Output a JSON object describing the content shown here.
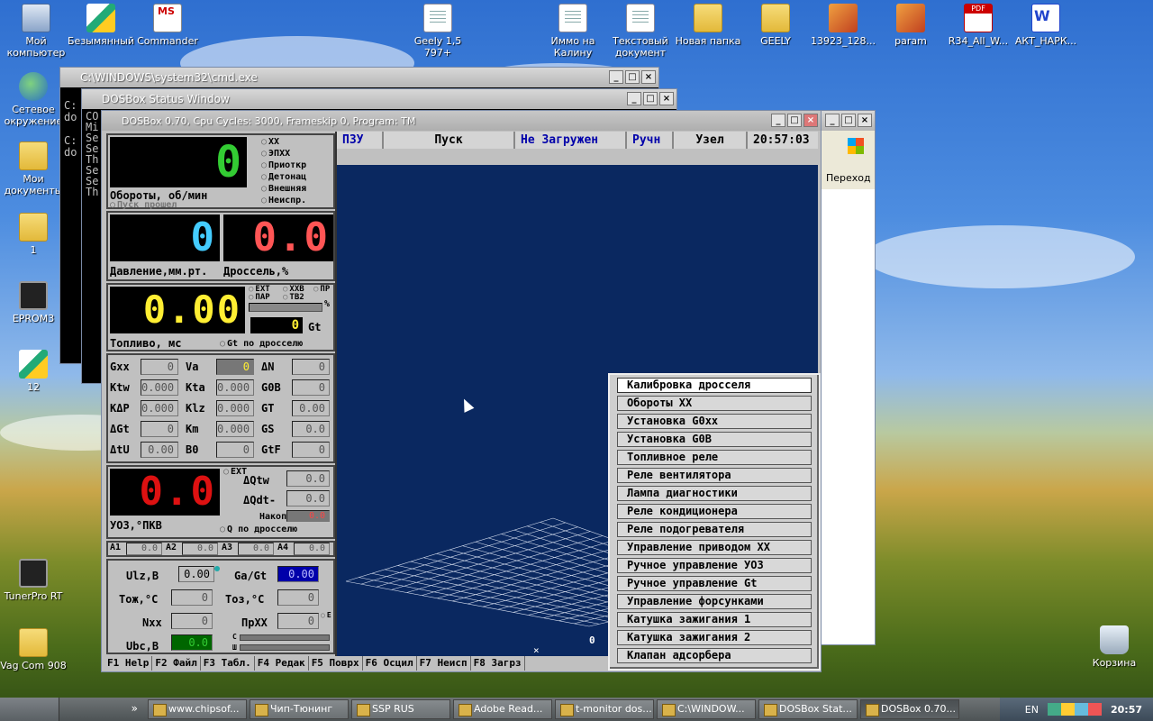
{
  "desktop_icons": [
    {
      "label": "Мой\nкомпьютер",
      "kind": "comp"
    },
    {
      "label": "Безымянный",
      "kind": "paint"
    },
    {
      "label": "Commander",
      "kind": "msdos"
    },
    {
      "label": "Geely 1,5\n797+",
      "kind": "doc"
    },
    {
      "label": "Иммо на\nКалину",
      "kind": "doc"
    },
    {
      "label": "Текстовый\nдокумент",
      "kind": "doc"
    },
    {
      "label": "Новая папка",
      "kind": "folder"
    },
    {
      "label": "GEELY",
      "kind": "folder"
    },
    {
      "label": "13923_128...",
      "kind": "pic"
    },
    {
      "label": "param",
      "kind": "pic"
    },
    {
      "label": "R34_All_W...",
      "kind": "pdf"
    },
    {
      "label": "АКТ_НАРК...",
      "kind": "word"
    },
    {
      "label": "Сетевое\nокружение",
      "kind": "net"
    },
    {
      "label": "Мои\nдокументы",
      "kind": "folder"
    },
    {
      "label": "1",
      "kind": "folder"
    },
    {
      "label": "EPROM3",
      "kind": "chip"
    },
    {
      "label": "12",
      "kind": "paint"
    },
    {
      "label": "TunerPro RT",
      "kind": "chip"
    },
    {
      "label": "Vag Com 908",
      "kind": "folder"
    },
    {
      "label": "Корзина",
      "kind": "bin"
    }
  ],
  "windows": {
    "cmd_title": "C:\\WINDOWS\\system32\\cmd.exe",
    "cmd_lines": [
      "C:",
      "do",
      "",
      "C:",
      "do"
    ],
    "status_title": "DOSBox Status Window",
    "status_lines": [
      "CO",
      "Mi",
      "Se",
      "Se",
      "Th",
      "Se",
      "Se",
      "Th"
    ],
    "dosbox_title": "DOSBox 0.70, Cpu Cycles:    3000, Frameskip  0, Program:    TM",
    "back_window_text": "Переход"
  },
  "app": {
    "status_bar": [
      "ПЗУ",
      "Пуск",
      "Не Загружен",
      "Ручн",
      "Узел",
      "20:57:03"
    ],
    "rpm": {
      "value": "0",
      "label": "Обороты, об/мин",
      "sub": "Пуск прошел"
    },
    "modes": [
      "ХХ",
      "ЭПХХ",
      "Приоткр",
      "Детонац",
      "Внешняя",
      "Неиспр."
    ],
    "pressure": {
      "value": "0",
      "label": "Давление,мм.рт."
    },
    "throttle": {
      "value": "0.0",
      "label": "Дроссель,%"
    },
    "fuel": {
      "value": "0.00",
      "label": "Топливо, мс",
      "gt_value": "0",
      "gt_unit": "Gt",
      "gt_opt": "Gt по дросселю",
      "pct": "%"
    },
    "fuel_opts": [
      "EXT",
      "XXB",
      "ПР",
      "ПАР",
      "ТВ2"
    ],
    "params": [
      {
        "k": "Gxx",
        "v": "0"
      },
      {
        "k": "Va",
        "v": "0"
      },
      {
        "k": "ΔN",
        "v": "0"
      },
      {
        "k": "Ktw",
        "v": "0.000"
      },
      {
        "k": "Kta",
        "v": "0.000"
      },
      {
        "k": "G0B",
        "v": "0"
      },
      {
        "k": "KΔP",
        "v": "0.000"
      },
      {
        "k": "Klz",
        "v": "0.000"
      },
      {
        "k": "GT",
        "v": "0.00"
      },
      {
        "k": "ΔGt",
        "v": "0"
      },
      {
        "k": "Km",
        "v": "0.000"
      },
      {
        "k": "GS",
        "v": "0.0"
      },
      {
        "k": "ΔtU",
        "v": "0.00"
      },
      {
        "k": "B0",
        "v": "0"
      },
      {
        "k": "GtF",
        "v": "0"
      }
    ],
    "uoz": {
      "value": "0.0",
      "label": "УОЗ,°ПКВ",
      "ext": "EXT",
      "dqtw": "ΔQtw",
      "dqtw_v": "0.0",
      "dqdt": "ΔQdt-",
      "dqdt_v": "0.0",
      "nakop": "Накоп",
      "nakop_v": "0.0",
      "q_opt": "Q по дросселю"
    },
    "a_values": [
      {
        "k": "A1",
        "v": "0.0"
      },
      {
        "k": "A2",
        "v": "0.0"
      },
      {
        "k": "A3",
        "v": "0.0"
      },
      {
        "k": "A4",
        "v": "0.0"
      }
    ],
    "bottom": [
      {
        "k": "Ulz,B",
        "v": "0.00"
      },
      {
        "k": "Ga/Gt",
        "v": "0.00"
      },
      {
        "k": "Тож,°C",
        "v": "0"
      },
      {
        "k": "Тоз,°C",
        "v": "0"
      },
      {
        "k": "Nxx",
        "v": "0"
      },
      {
        "k": "ПрХХ",
        "v": "0"
      },
      {
        "k": "Ubc,B",
        "v": "0.0"
      }
    ],
    "bottom_marks": {
      "e": "E",
      "c": "C",
      "w": "Ш"
    },
    "graph_value": "0",
    "menu": [
      "Калибровка дросселя",
      "Обороты ХХ",
      "Установка G0хх",
      "Установка G0B",
      "Топливное реле",
      "Реле вентилятора",
      "Лампа диагностики",
      "Реле кондиционера",
      "Реле подогревателя",
      "Управление приводом ХХ",
      "Ручное управление УОЗ",
      "Ручное управление Gt",
      "Управление форсунками",
      "Катушка зажигания 1",
      "Катушка зажигания 2",
      "Клапан адсорбера"
    ],
    "fkeys": [
      "F1 Help",
      "F2 Файл",
      "F3 Табл.",
      "F4 Редак",
      "F5 Поврх",
      "F6 Осцил",
      "F7 Неисп",
      "F8 Загрз"
    ]
  },
  "taskbar": {
    "items": [
      "www.chipsof...",
      "Чип-Тюнинг",
      "SSP RUS",
      "Adobe Read...",
      "t-monitor dos...",
      "C:\\WINDOW...",
      "DOSBox Stat...",
      "DOSBox 0.70..."
    ],
    "lang": "EN",
    "clock": "20:57",
    "more": "»"
  }
}
